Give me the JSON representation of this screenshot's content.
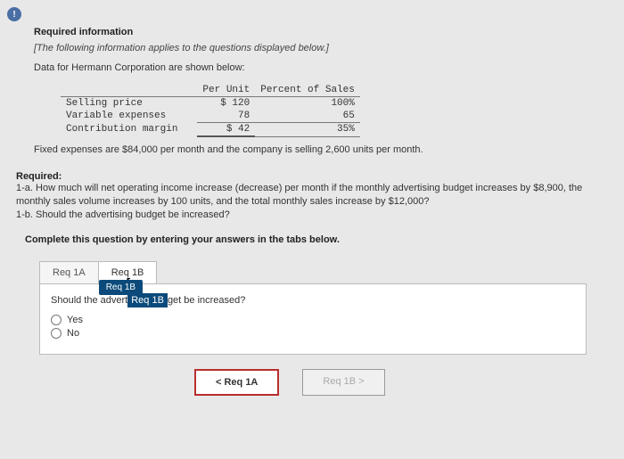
{
  "badge": "!",
  "section_title": "Required information",
  "italic_note": "[The following information applies to the questions displayed below.]",
  "data_intro": "Data for Hermann Corporation are shown below:",
  "table": {
    "h1": "Per Unit",
    "h2": "Percent of Sales",
    "r1_label": "Selling price",
    "r1_c1": "$ 120",
    "r1_c2": "100%",
    "r2_label": "Variable expenses",
    "r2_c1": "78",
    "r2_c2": "65",
    "r3_label": "Contribution margin",
    "r3_c1": "$ 42",
    "r3_c2": "35%"
  },
  "fixed_line": "Fixed expenses are $84,000 per month and the company is selling 2,600 units per month.",
  "required_title": "Required:",
  "required_body_1": "1-a. How much will net operating income increase (decrease) per month if the monthly advertising budget increases by $8,900, the monthly sales volume increases by 100 units, and the total monthly sales increase by $12,000?",
  "required_body_2": "1-b. Should the advertising budget be increased?",
  "instruction": "Complete this question by entering your answers in the tabs below.",
  "tabs": {
    "a": "Req 1A",
    "b": "Req 1B"
  },
  "tooltip": "Req 1B",
  "pane_question_pre": "Should the advert",
  "pane_question_post": "get be increased?",
  "options": {
    "yes": "Yes",
    "no": "No"
  },
  "nav": {
    "prev": "<  Req 1A",
    "next": "Req 1B  >"
  }
}
